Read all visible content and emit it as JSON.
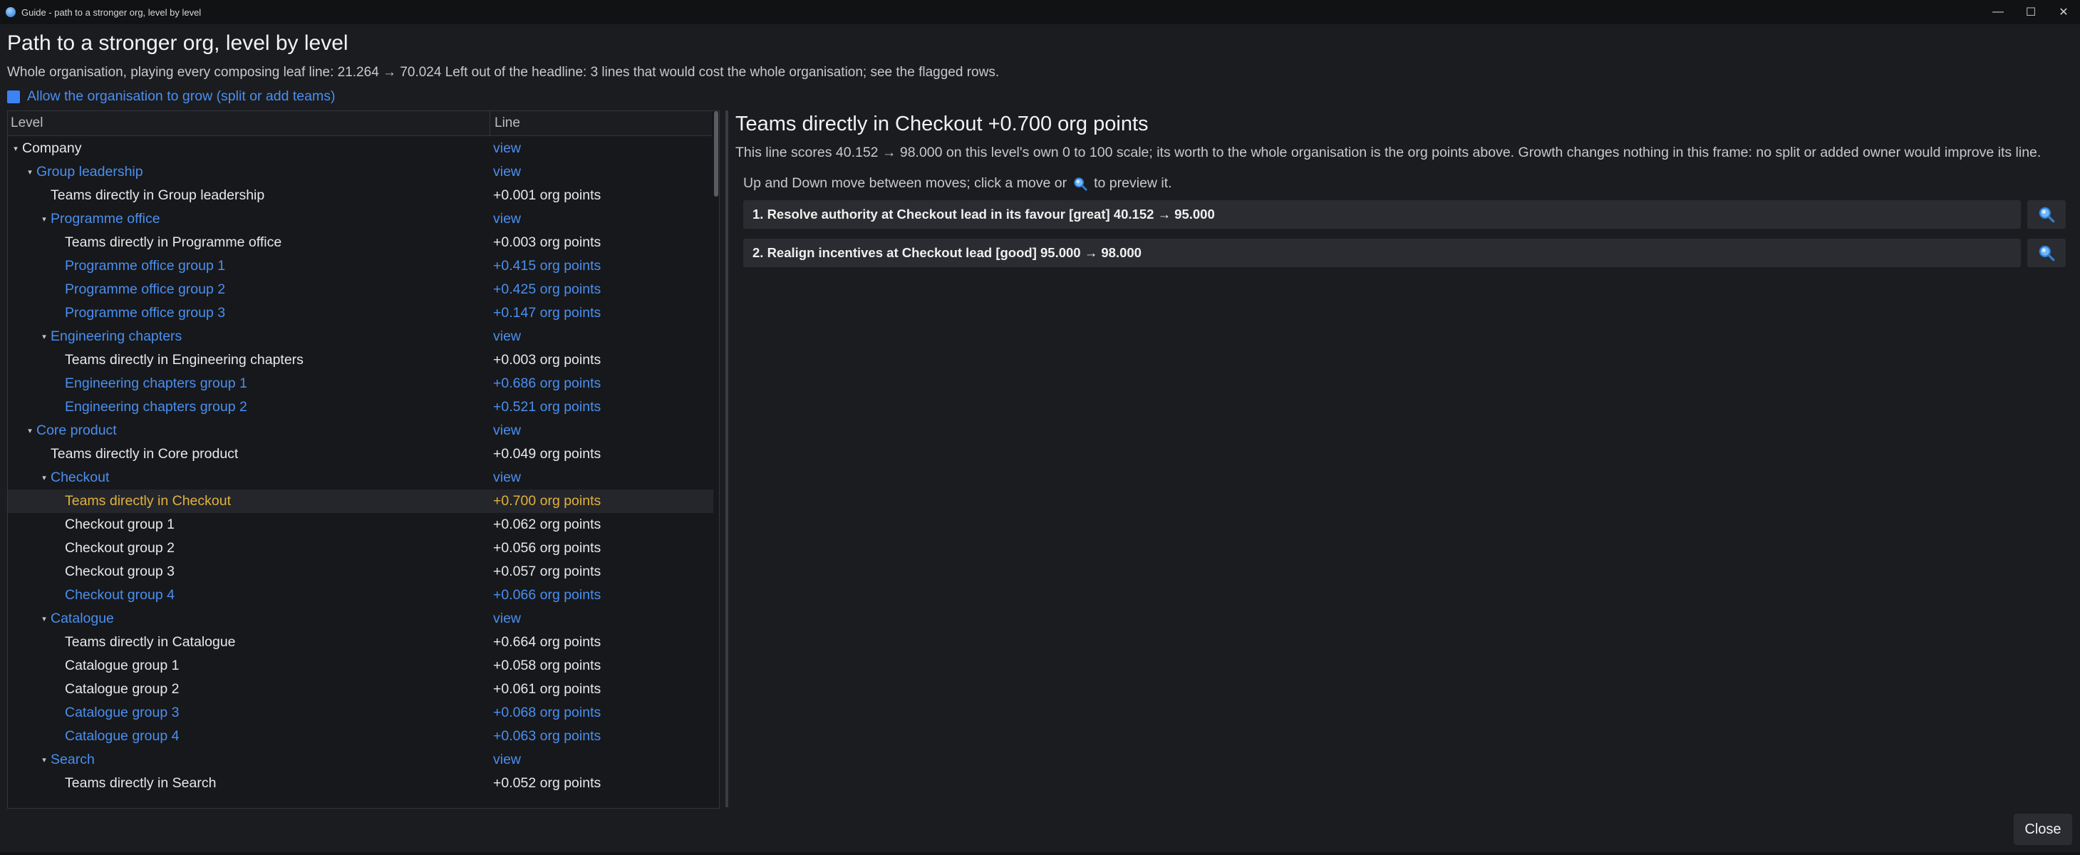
{
  "window": {
    "title": "Guide - path to a stronger org, level by level",
    "controls": {
      "minimize": "—",
      "maximize": "☐",
      "close": "✕"
    }
  },
  "header": {
    "title": "Path to a stronger org, level by level",
    "summary": "Whole organisation, playing every composing leaf line: 21.264 → 70.024   Left out of the headline: 3 lines that would cost the whole organisation; see the flagged rows.",
    "grow_label": "Allow the organisation to grow (split or add teams)"
  },
  "tree": {
    "columns": {
      "level": "Level",
      "line": "Line"
    },
    "rows": [
      {
        "label": "Company",
        "value": "view",
        "depth": 0,
        "expandable": true,
        "style": "white"
      },
      {
        "label": "Group leadership",
        "value": "view",
        "depth": 1,
        "expandable": true,
        "style": "link"
      },
      {
        "label": "Teams directly in Group leadership",
        "value": "+0.001 org points",
        "depth": 2,
        "expandable": false,
        "style": "white"
      },
      {
        "label": "Programme office",
        "value": "view",
        "depth": 2,
        "expandable": true,
        "style": "link"
      },
      {
        "label": "Teams directly in Programme office",
        "value": "+0.003 org points",
        "depth": 3,
        "expandable": false,
        "style": "white"
      },
      {
        "label": "Programme office group 1",
        "value": "+0.415 org points",
        "depth": 3,
        "expandable": false,
        "style": "link"
      },
      {
        "label": "Programme office group 2",
        "value": "+0.425 org points",
        "depth": 3,
        "expandable": false,
        "style": "link"
      },
      {
        "label": "Programme office group 3",
        "value": "+0.147 org points",
        "depth": 3,
        "expandable": false,
        "style": "link"
      },
      {
        "label": "Engineering chapters",
        "value": "view",
        "depth": 2,
        "expandable": true,
        "style": "link"
      },
      {
        "label": "Teams directly in Engineering chapters",
        "value": "+0.003 org points",
        "depth": 3,
        "expandable": false,
        "style": "white"
      },
      {
        "label": "Engineering chapters group 1",
        "value": "+0.686 org points",
        "depth": 3,
        "expandable": false,
        "style": "link"
      },
      {
        "label": "Engineering chapters group 2",
        "value": "+0.521 org points",
        "depth": 3,
        "expandable": false,
        "style": "link"
      },
      {
        "label": "Core product",
        "value": "view",
        "depth": 1,
        "expandable": true,
        "style": "link"
      },
      {
        "label": "Teams directly in Core product",
        "value": "+0.049 org points",
        "depth": 2,
        "expandable": false,
        "style": "white"
      },
      {
        "label": "Checkout",
        "value": "view",
        "depth": 2,
        "expandable": true,
        "style": "link"
      },
      {
        "label": "Teams directly in Checkout",
        "value": "+0.700 org points",
        "depth": 3,
        "expandable": false,
        "style": "gold",
        "selected": true
      },
      {
        "label": "Checkout group 1",
        "value": "+0.062 org points",
        "depth": 3,
        "expandable": false,
        "style": "white"
      },
      {
        "label": "Checkout group 2",
        "value": "+0.056 org points",
        "depth": 3,
        "expandable": false,
        "style": "white"
      },
      {
        "label": "Checkout group 3",
        "value": "+0.057 org points",
        "depth": 3,
        "expandable": false,
        "style": "white"
      },
      {
        "label": "Checkout group 4",
        "value": "+0.066 org points",
        "depth": 3,
        "expandable": false,
        "style": "link"
      },
      {
        "label": "Catalogue",
        "value": "view",
        "depth": 2,
        "expandable": true,
        "style": "link"
      },
      {
        "label": "Teams directly in Catalogue",
        "value": "+0.664 org points",
        "depth": 3,
        "expandable": false,
        "style": "white"
      },
      {
        "label": "Catalogue group 1",
        "value": "+0.058 org points",
        "depth": 3,
        "expandable": false,
        "style": "white"
      },
      {
        "label": "Catalogue group 2",
        "value": "+0.061 org points",
        "depth": 3,
        "expandable": false,
        "style": "white"
      },
      {
        "label": "Catalogue group 3",
        "value": "+0.068 org points",
        "depth": 3,
        "expandable": false,
        "style": "link"
      },
      {
        "label": "Catalogue group 4",
        "value": "+0.063 org points",
        "depth": 3,
        "expandable": false,
        "style": "link"
      },
      {
        "label": "Search",
        "value": "view",
        "depth": 2,
        "expandable": true,
        "style": "link"
      },
      {
        "label": "Teams directly in Search",
        "value": "+0.052 org points",
        "depth": 3,
        "expandable": false,
        "style": "white"
      }
    ]
  },
  "detail": {
    "title": "Teams directly in Checkout   +0.700 org points",
    "description": "This line scores 40.152 → 98.000 on this level's own 0 to 100 scale; its worth to the whole organisation is the org points above. Growth changes nothing in this frame: no split or added owner would improve its line.",
    "hint_before": "Up and Down move between moves; click a move or",
    "hint_after": "to preview it.",
    "moves": [
      {
        "text": "1. Resolve authority at Checkout lead in its favour   [great]   40.152 → 95.000"
      },
      {
        "text": "2. Realign incentives at Checkout lead   [good]   95.000 → 98.000"
      }
    ]
  },
  "footer": {
    "close_label": "Close"
  },
  "icons": {
    "preview": "magnifier-icon",
    "expand": "chevron-down-icon"
  },
  "colors": {
    "link": "#4a8ff0",
    "selected": "#e0b23a",
    "background": "#1b1c20",
    "checkbox": "#3b82f6"
  }
}
